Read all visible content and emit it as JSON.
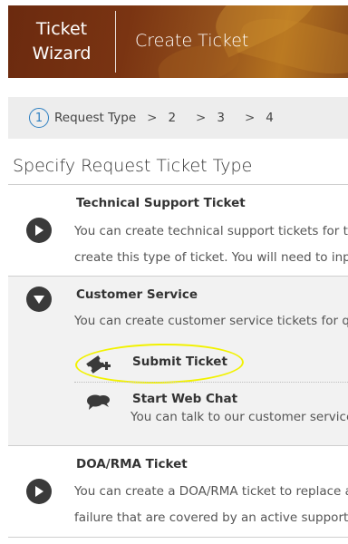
{
  "header": {
    "wizard_title": "Ticket\nWizard",
    "page_title": "Create Ticket"
  },
  "steps": {
    "current_number": "1",
    "current_label": "Request Type",
    "separator": ">",
    "others": [
      "2",
      "3",
      "4"
    ]
  },
  "section_title": "Specify Request Ticket Type",
  "ticket_types": [
    {
      "title": "Technical Support Ticket",
      "description_lines": [
        "You can create technical support tickets for tec",
        "create this type of ticket. You will need to input"
      ],
      "expanded": false
    },
    {
      "title": "Customer Service",
      "description_lines": [
        "You can create customer service tickets for que"
      ],
      "expanded": true,
      "options": [
        {
          "label": "Submit Ticket",
          "icon": "ticket-plus-icon"
        },
        {
          "label": "Start Web Chat",
          "description": "You can talk to our customer service",
          "icon": "chat-bubbles-icon"
        }
      ]
    },
    {
      "title": "DOA/RMA Ticket",
      "description_lines": [
        "You can create a DOA/RMA ticket to replace a r",
        "failure that are covered by an active support co"
      ],
      "expanded": false
    }
  ],
  "colors": {
    "header_brown": "#7a3412",
    "step_circle_blue": "#2d7fc1",
    "highlight_yellow": "#f2f200"
  }
}
